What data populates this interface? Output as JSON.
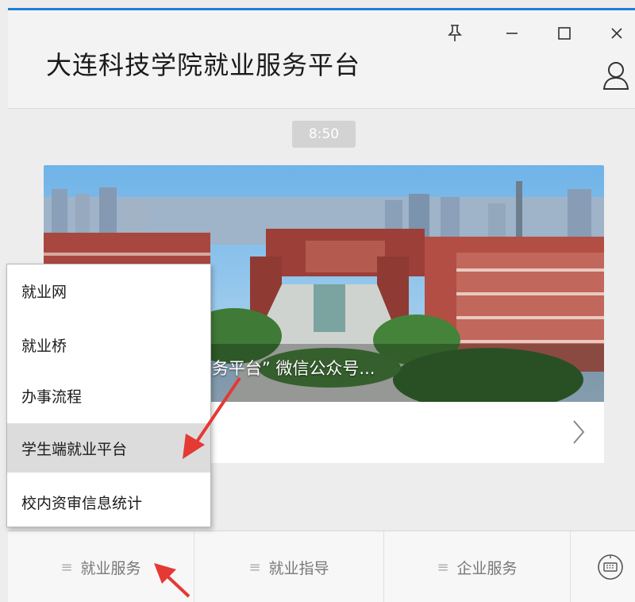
{
  "window": {
    "title": "大连科技学院就业服务平台",
    "controls": [
      "pin-icon",
      "minimize-icon",
      "maximize-icon",
      "close-icon"
    ],
    "accent_color": "#1f7fd1"
  },
  "chat": {
    "timestamp": "8:50",
    "article_card": {
      "caption": "“大连科技学院就业服务平台” 微信公众号...",
      "visible_caption": "科技学院就业服务平台” 微信公众号..."
    }
  },
  "popup_menu": {
    "items": [
      {
        "label": "就业网"
      },
      {
        "label": "就业桥"
      },
      {
        "label": "办事流程"
      },
      {
        "label": "学生端就业平台",
        "selected": true
      },
      {
        "label": "校内资审信息统计"
      }
    ]
  },
  "bottom_menu": {
    "tabs": [
      {
        "label": "就业服务"
      },
      {
        "label": "就业指导"
      },
      {
        "label": "企业服务"
      }
    ],
    "keyboard_icon": "keyboard-icon"
  },
  "annotation": {
    "arrow_color": "#e53935"
  }
}
